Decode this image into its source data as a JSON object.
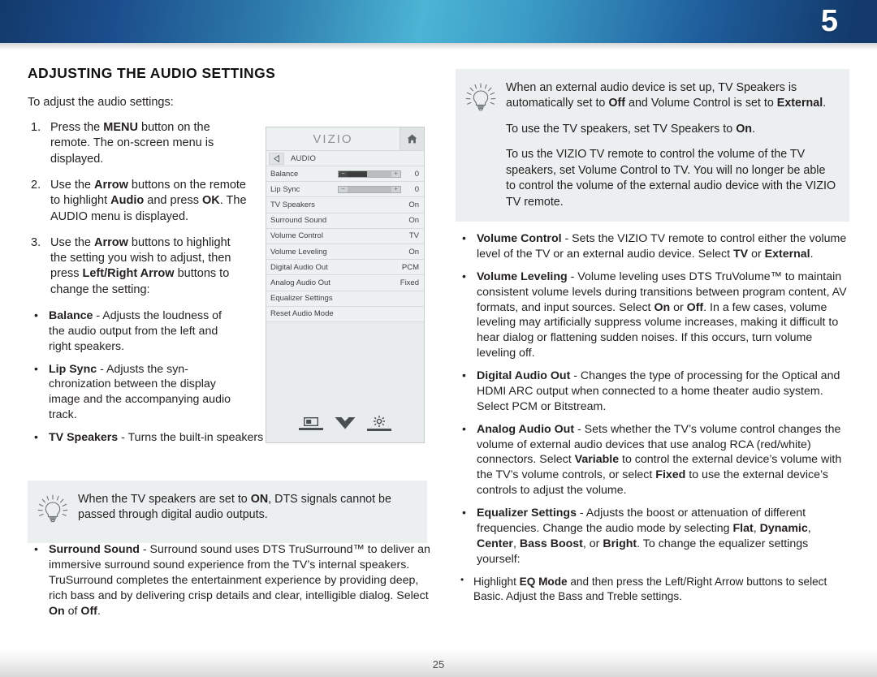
{
  "banner": {
    "chapter_number": "5"
  },
  "page": {
    "number": "25"
  },
  "left": {
    "title": "ADJUSTING THE AUDIO SETTINGS",
    "intro": "To adjust the audio settings:",
    "steps": [
      {
        "num": "1.",
        "html": "Press the <b>MENU</b> button on the remote. The on-screen menu is displayed."
      },
      {
        "num": "2.",
        "html": "Use the <b>Arrow</b> buttons on the remote to highlight <b>Audio</b> and press <b>OK</b>. The AUDIO menu is displayed."
      },
      {
        "num": "3.",
        "html": "Use the <b>Arrow</b> buttons to highlight the setting you wish to adjust, then press <b>Left/Right Arrow</b> buttons to change the setting:"
      }
    ],
    "bullets_narrow": [
      {
        "html": "<b>Balance</b> - Adjusts the loudness of the audio output from the left and right speakers."
      },
      {
        "html": "<b>Lip Sync</b> - Adjusts the syn-chronization between the display image and the accompanying audio track."
      }
    ],
    "bullets_wide": [
      {
        "html": "<b>TV Speakers</b> - Turns the built-in speakers on or off."
      }
    ],
    "tip": {
      "icon": "lightbulb-icon",
      "paragraphs": [
        "When the TV speakers are set to <b>ON</b>, DTS signals cannot be passed through digital audio outputs."
      ]
    },
    "bullets_after_tip": [
      {
        "html": "<b>Surround Sound</b> - Surround sound uses DTS TruSurround&trade; to deliver an immersive surround sound experience from the TV’s internal speakers. TruSurround completes the entertainment experience by providing deep, rich bass and by delivering crisp details and clear, intelligible dialog. Select <b>On</b> of <b>Off</b>."
      }
    ]
  },
  "osd": {
    "logo": "VIZIO",
    "home_icon": "home-icon",
    "back_icon": "back-arrow-icon",
    "breadcrumb": "AUDIO",
    "rows": [
      {
        "label": "Balance",
        "type": "slider",
        "value": "0",
        "fill_pct": 46,
        "dark": true
      },
      {
        "label": "Lip Sync",
        "type": "slider",
        "value": "0",
        "fill_pct": 0,
        "dark": false
      },
      {
        "label": "TV Speakers",
        "type": "value",
        "value": "On"
      },
      {
        "label": "Surround Sound",
        "type": "value",
        "value": "On"
      },
      {
        "label": "Volume Control",
        "type": "value",
        "value": "TV"
      },
      {
        "label": "Volume Leveling",
        "type": "value",
        "value": "On"
      },
      {
        "label": "Digital Audio Out",
        "type": "value",
        "value": "PCM"
      },
      {
        "label": "Analog Audio Out",
        "type": "value",
        "value": "Fixed"
      },
      {
        "label": "Equalizer Settings",
        "type": "value",
        "value": ""
      },
      {
        "label": "Reset Audio Mode",
        "type": "value",
        "value": ""
      }
    ],
    "footer_icons": [
      "screen-icon",
      "vizio-v-icon",
      "gear-icon"
    ]
  },
  "right": {
    "tip": {
      "icon": "lightbulb-icon",
      "paragraphs": [
        "When an external audio device is set up, TV Speakers is automatically set to <b>Off</b> and Volume Control is set to <b>External</b>.",
        "To use the TV speakers, set TV Speakers to <b>On</b>.",
        "To us the VIZIO TV remote to control the volume of the TV speakers, set Volume Control to TV. You will no longer be able to control the volume of the external audio device with the VIZIO TV remote."
      ]
    },
    "bullets": [
      {
        "html": "<b>Volume Control</b> - Sets the VIZIO TV remote to control either the volume level of the TV or an external audio device. Select <b>TV</b> or <b>External</b>."
      },
      {
        "html": "<b>Volume Leveling</b> - Volume leveling uses DTS TruVolume&trade; to maintain consistent volume levels during transitions between program content, AV formats, and input sources. Select <b>On</b> or <b>Off</b>. In a few cases, volume leveling may artificially suppress volume increases, making it difficult to hear dialog or flattening sudden noises. If this occurs, turn volume leveling off."
      },
      {
        "html": "<b>Digital Audio Out</b> - Changes the type of processing for the Optical and HDMI ARC output when connected to a home theater audio system. Select PCM or Bitstream."
      },
      {
        "html": "<b>Analog Audio Out</b> - Sets whether the TV’s volume control changes the volume of external audio devices that use analog RCA (red/white) connectors. Select <b>Variable</b> to control the external device’s volume with the TV’s volume controls, or select <b>Fixed</b> to use the external device’s controls to adjust the volume."
      },
      {
        "html": "<b>Equalizer Settings</b> - Adjusts the boost or attenuation of different frequencies. Change the audio mode by selecting <b>Flat</b>, <b>Dynamic</b>, <b>Center</b>, <b>Bass Boost</b>, or <b>Bright</b>. To change the equalizer settings yourself:"
      }
    ],
    "sub_bullets": [
      {
        "html": "Highlight <b>EQ Mode</b> and then press the Left/Right Arrow buttons to select Basic. Adjust the Bass and Treble settings."
      }
    ]
  },
  "colors": {
    "banner_dark": "#133a6b",
    "banner_light": "#4cb4d4",
    "tip_bg": "#eceff0",
    "osd_bg": "#e9ecec",
    "osd_row": "#eef1f1",
    "text": "#231f20"
  }
}
